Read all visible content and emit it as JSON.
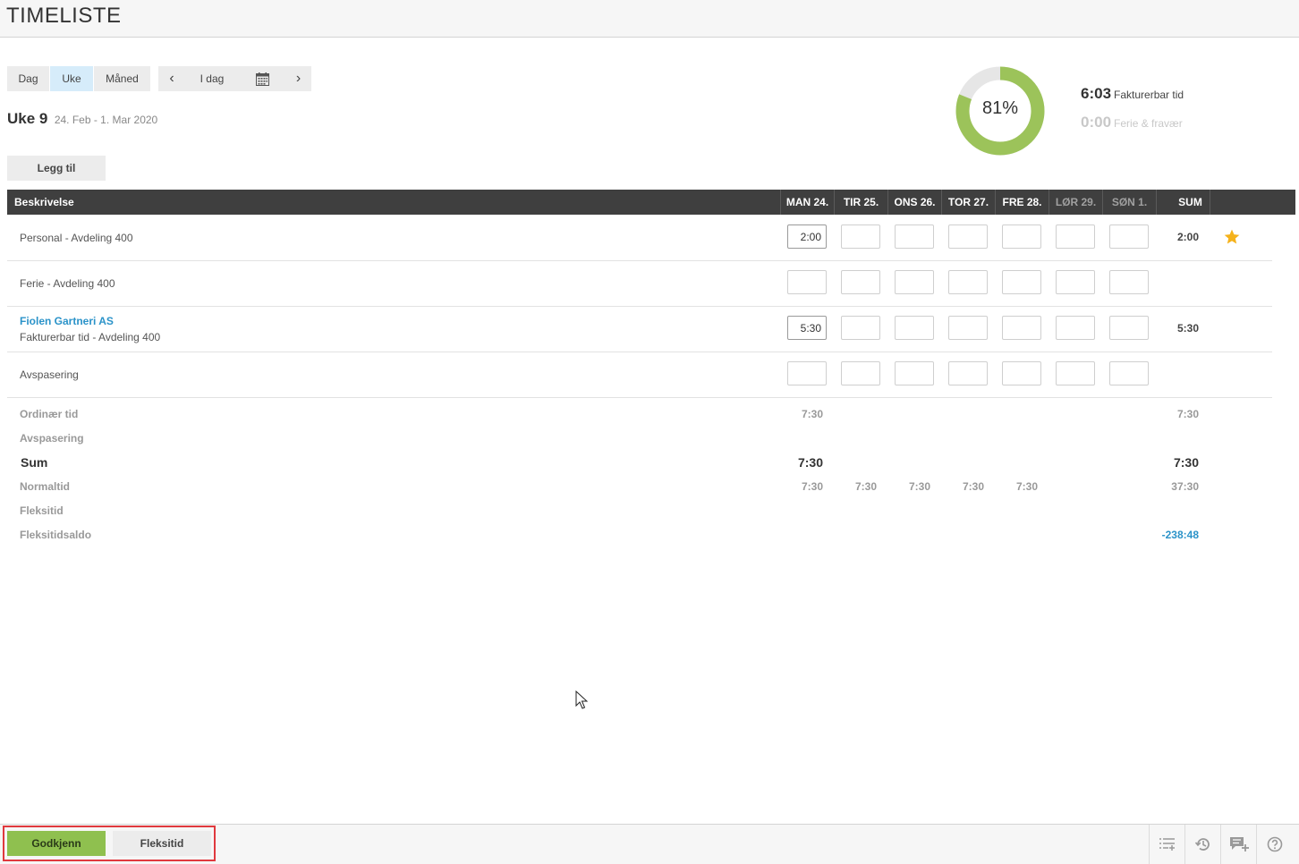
{
  "app": {
    "title": "TIMELISTE"
  },
  "view_switch": {
    "day": "Dag",
    "week": "Uke",
    "month": "Måned",
    "active": "Uke"
  },
  "date_nav": {
    "prev": "‹",
    "today": "I dag",
    "next": "›"
  },
  "week": {
    "title": "Uke 9",
    "range": "24. Feb - 1. Mar 2020"
  },
  "add_button": "Legg til",
  "summary": {
    "percent_label": "81%",
    "percent_value": 81,
    "billable_value": "6:03",
    "billable_label": "Fakturerbar tid",
    "absence_value": "0:00",
    "absence_label": "Ferie & fravær",
    "colors": {
      "donut_fill": "#9cc35a",
      "donut_rest": "#e6e6e6"
    }
  },
  "grid": {
    "columns": {
      "description": "Beskrivelse",
      "days": [
        "MAN 24.",
        "TIR 25.",
        "ONS 26.",
        "TOR 27.",
        "FRE 28.",
        "LØR 29.",
        "SØN 1."
      ],
      "sum": "SUM"
    },
    "rows": [
      {
        "client": "",
        "description": "Personal - Avdeling 400",
        "values": [
          "2:00",
          "",
          "",
          "",
          "",
          "",
          ""
        ],
        "sum": "2:00",
        "favorite": true
      },
      {
        "client": "",
        "description": "Ferie - Avdeling 400",
        "values": [
          "",
          "",
          "",
          "",
          "",
          "",
          ""
        ],
        "sum": "",
        "favorite": false
      },
      {
        "client": "Fiolen Gartneri AS",
        "description": "Fakturerbar tid - Avdeling 400",
        "values": [
          "5:30",
          "",
          "",
          "",
          "",
          "",
          ""
        ],
        "sum": "5:30",
        "favorite": false
      },
      {
        "client": "",
        "description": "Avspasering",
        "values": [
          "",
          "",
          "",
          "",
          "",
          "",
          ""
        ],
        "sum": "",
        "favorite": false
      }
    ]
  },
  "totals": {
    "ordinary": {
      "label": "Ordinær tid",
      "values": [
        "7:30",
        "",
        "",
        "",
        "",
        "",
        ""
      ],
      "sum": "7:30"
    },
    "time_off": {
      "label": "Avspasering",
      "values": [
        "",
        "",
        "",
        "",
        "",
        "",
        ""
      ],
      "sum": ""
    },
    "sum": {
      "label": "Sum",
      "values": [
        "7:30",
        "",
        "",
        "",
        "",
        "",
        ""
      ],
      "sum": "7:30"
    },
    "normal": {
      "label": "Normaltid",
      "values": [
        "7:30",
        "7:30",
        "7:30",
        "7:30",
        "7:30",
        "",
        ""
      ],
      "sum": "37:30"
    },
    "flex": {
      "label": "Fleksitid",
      "values": [
        "",
        "",
        "",
        "",
        "",
        "",
        ""
      ],
      "sum": ""
    },
    "flex_balance": {
      "label": "Fleksitidsaldo",
      "values": [
        "",
        "",
        "",
        "",
        "",
        "",
        ""
      ],
      "sum": "-238:48"
    }
  },
  "footer": {
    "approve": "Godkjenn",
    "flextime": "Fleksitid",
    "icons": [
      "add-list-icon",
      "history-icon",
      "add-comment-icon",
      "help-icon"
    ]
  }
}
